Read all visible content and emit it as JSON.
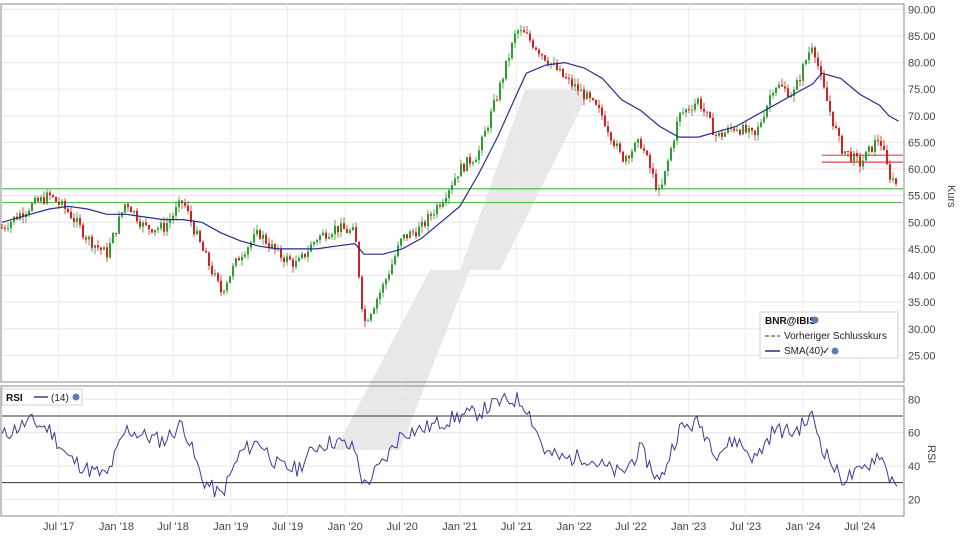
{
  "chart_data": {
    "type": "line",
    "price_panel": {
      "symbol": "BNR@IBIS",
      "ylabel": "Kurs",
      "ylim": [
        20,
        91
      ],
      "yticks": [
        25,
        30,
        35,
        40,
        45,
        50,
        55,
        60,
        65,
        70,
        75,
        80,
        85,
        90
      ],
      "ytick_labels": [
        "25.00",
        "30.00",
        "35.00",
        "40.00",
        "45.00",
        "50.00",
        "55.00",
        "60.00",
        "65.00",
        "70.00",
        "75.00",
        "80.00",
        "85.00",
        "90.00"
      ],
      "legend": {
        "title": "BNR@IBIS",
        "items": [
          {
            "label": "Vorheriger Schlusskurs",
            "style": "dashed",
            "color": "#333333"
          },
          {
            "label": "SMA(40)",
            "style": "solid",
            "color": "#2b2b8a"
          }
        ]
      },
      "support_lines_green": [
        56.3,
        53.7
      ],
      "resistance_lines_red": [
        62.6,
        61.3
      ],
      "colors": {
        "up": "#2e9e2e",
        "down": "#d42020",
        "sma": "#2b2b8a",
        "support": "#55bb55",
        "resistance": "#dd4444"
      },
      "x": [
        "2017-01",
        "2017-04",
        "2017-06",
        "2017-08",
        "2017-10",
        "2017-12",
        "2018-02",
        "2018-04",
        "2018-06",
        "2018-08",
        "2018-10",
        "2018-12",
        "2019-02",
        "2019-04",
        "2019-06",
        "2019-08",
        "2019-10",
        "2019-12",
        "2020-02",
        "2020-03",
        "2020-05",
        "2020-07",
        "2020-09",
        "2020-11",
        "2021-01",
        "2021-03",
        "2021-05",
        "2021-07",
        "2021-08",
        "2021-10",
        "2021-12",
        "2022-02",
        "2022-04",
        "2022-06",
        "2022-08",
        "2022-10",
        "2022-12",
        "2023-02",
        "2023-04",
        "2023-06",
        "2023-08",
        "2023-10",
        "2023-12",
        "2024-02",
        "2024-03",
        "2024-05",
        "2024-07",
        "2024-09",
        "2024-10",
        "2024-11"
      ],
      "close": [
        49,
        53,
        55,
        52,
        47,
        44,
        54,
        49,
        49,
        54,
        45,
        37,
        44,
        48,
        44,
        42,
        47,
        49,
        48,
        31,
        38,
        47,
        49,
        54,
        60,
        63,
        74,
        86,
        85,
        81,
        77,
        74,
        70,
        62,
        65,
        55,
        70,
        73,
        66,
        68,
        66,
        76,
        74,
        84,
        76,
        64,
        61,
        66,
        59,
        57
      ],
      "sma": [
        50,
        51.5,
        52.5,
        53,
        52.5,
        51.5,
        51.5,
        51,
        50.5,
        50.5,
        50,
        48,
        46.5,
        45.5,
        45,
        45,
        45,
        45.5,
        46,
        44,
        44,
        45,
        47,
        50,
        53,
        59,
        66,
        74,
        78,
        79.5,
        80,
        79,
        77,
        73,
        71,
        68,
        66,
        66,
        67,
        68,
        70,
        72,
        74,
        76,
        78,
        77,
        74,
        72,
        70,
        69
      ]
    },
    "rsi_panel": {
      "label": "RSI",
      "period_label": "(14)",
      "ylabel": "RSI",
      "ylim": [
        10,
        88
      ],
      "yticks": [
        20,
        40,
        60,
        80
      ],
      "ref_lines": [
        70,
        30
      ],
      "color": "#3a3a99",
      "values": [
        58,
        67,
        62,
        45,
        38,
        34,
        62,
        58,
        55,
        66,
        32,
        22,
        48,
        55,
        40,
        38,
        52,
        55,
        50,
        28,
        42,
        60,
        62,
        66,
        70,
        72,
        78,
        80,
        76,
        48,
        44,
        46,
        40,
        35,
        50,
        30,
        62,
        66,
        48,
        56,
        44,
        62,
        60,
        70,
        52,
        32,
        36,
        48,
        34,
        30
      ]
    },
    "xaxis_ticks": [
      {
        "label": "Jul '17",
        "date": "2017-07"
      },
      {
        "label": "Jan '18",
        "date": "2018-01"
      },
      {
        "label": "Jul '18",
        "date": "2018-07"
      },
      {
        "label": "Jan '19",
        "date": "2019-01"
      },
      {
        "label": "Jul '19",
        "date": "2019-07"
      },
      {
        "label": "Jan '20",
        "date": "2020-01"
      },
      {
        "label": "Jul '20",
        "date": "2020-07"
      },
      {
        "label": "Jan '21",
        "date": "2021-01"
      },
      {
        "label": "Jul '21",
        "date": "2021-07"
      },
      {
        "label": "Jan '22",
        "date": "2022-01"
      },
      {
        "label": "Jul '22",
        "date": "2022-07"
      },
      {
        "label": "Jan '23",
        "date": "2023-01"
      },
      {
        "label": "Jul '23",
        "date": "2023-07"
      },
      {
        "label": "Jan '24",
        "date": "2024-01"
      },
      {
        "label": "Jul '24",
        "date": "2024-07"
      }
    ],
    "grid": true,
    "legend_position": "bottom-right"
  }
}
